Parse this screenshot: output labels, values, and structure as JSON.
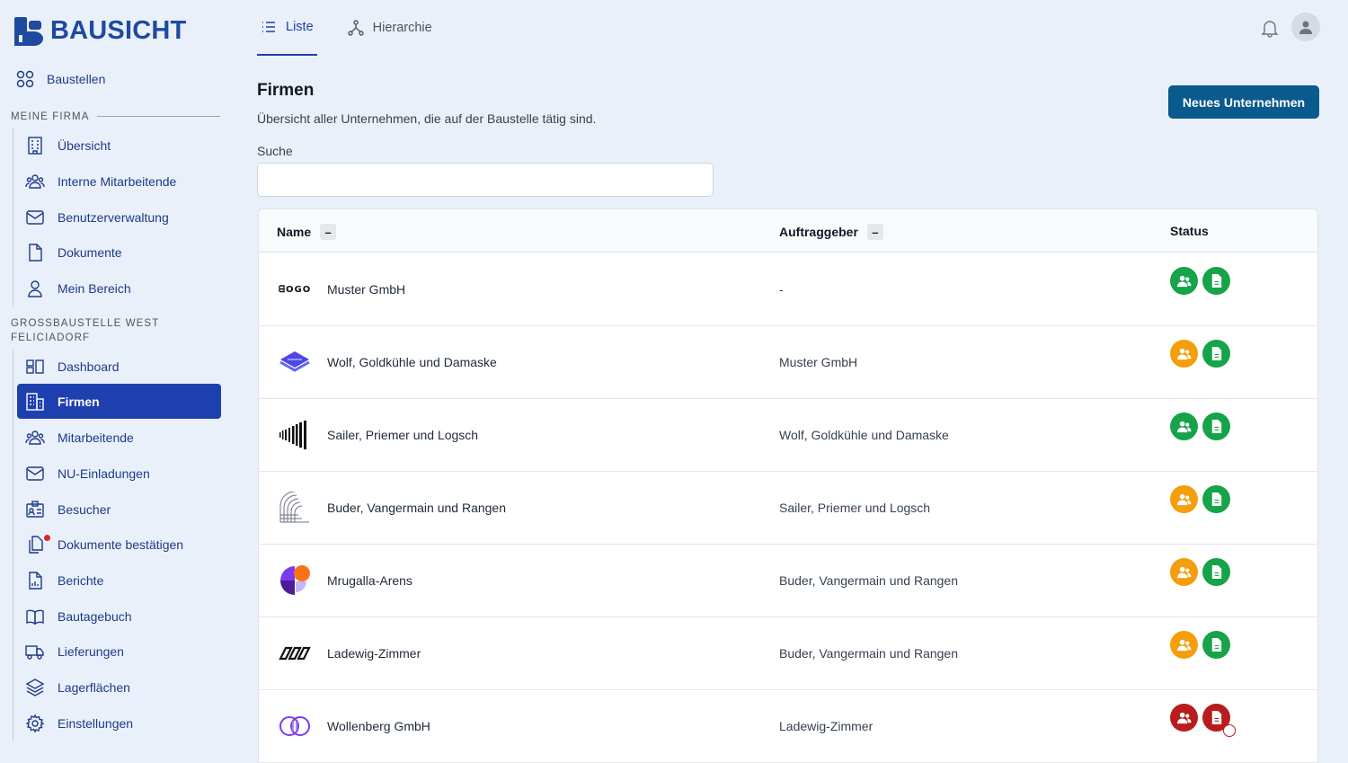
{
  "app": {
    "brand": "BAUSICHT"
  },
  "colors": {
    "brand": "#1e4aa0",
    "active_nav": "#1e40af",
    "primary_button": "#0b5a8e",
    "status_ok": "#16a34a",
    "status_warn": "#f59e0b",
    "status_error": "#b91c1c"
  },
  "sidebar": {
    "top_item": {
      "label": "Baustellen",
      "icon": "grid-icon"
    },
    "section1": "MEINE FIRMA",
    "group1": [
      {
        "label": "Übersicht",
        "icon": "building-icon"
      },
      {
        "label": "Interne Mitarbeitende",
        "icon": "users-icon"
      },
      {
        "label": "Benutzerverwaltung",
        "icon": "envelope-icon"
      },
      {
        "label": "Dokumente",
        "icon": "document-icon"
      },
      {
        "label": "Mein Bereich",
        "icon": "user-icon"
      }
    ],
    "section2_line1": "GROSSBAUSTELLE WEST",
    "section2_line2": "FELICIADORF",
    "group2": [
      {
        "label": "Dashboard",
        "icon": "dashboard-icon"
      },
      {
        "label": "Firmen",
        "icon": "building-icon",
        "active": true
      },
      {
        "label": "Mitarbeitende",
        "icon": "users-icon"
      },
      {
        "label": "NU-Einladungen",
        "icon": "envelope-icon"
      },
      {
        "label": "Besucher",
        "icon": "id-card-icon"
      },
      {
        "label": "Dokumente bestätigen",
        "icon": "documents-icon",
        "notification": true
      },
      {
        "label": "Berichte",
        "icon": "report-icon"
      },
      {
        "label": "Bautagebuch",
        "icon": "book-icon"
      },
      {
        "label": "Lieferungen",
        "icon": "truck-icon"
      },
      {
        "label": "Lagerflächen",
        "icon": "layers-icon"
      },
      {
        "label": "Einstellungen",
        "icon": "gear-icon"
      }
    ]
  },
  "header": {
    "tabs": [
      {
        "label": "Liste",
        "icon": "list-icon",
        "active": true
      },
      {
        "label": "Hierarchie",
        "icon": "hierarchy-icon"
      }
    ]
  },
  "main": {
    "title": "Firmen",
    "subtitle": "Übersicht aller Unternehmen, die auf der Baustelle tätig sind.",
    "new_button": "Neues Unternehmen",
    "search_label": "Suche",
    "search_value": "",
    "columns": {
      "name": "Name",
      "client": "Auftraggeber",
      "status": "Status",
      "collapse": "–"
    },
    "rows": [
      {
        "logo": "logo-text",
        "logo_text": "ᗺOGO",
        "name": "Muster GmbH",
        "client": "-",
        "staff_status": "green",
        "doc_status": "green"
      },
      {
        "logo": "layers-logo",
        "name": "Wolf, Goldkühle und Damaske",
        "client": "Muster GmbH",
        "staff_status": "orange",
        "doc_status": "green"
      },
      {
        "logo": "bars-logo",
        "name": "Sailer, Priemer und Logsch",
        "client": "Wolf, Goldkühle und Damaske",
        "staff_status": "green",
        "doc_status": "green"
      },
      {
        "logo": "stack-logo",
        "name": "Buder, Vangermain und Rangen",
        "client": "Sailer, Priemer und Logsch",
        "staff_status": "orange",
        "doc_status": "green"
      },
      {
        "logo": "pie-logo",
        "name": "Mrugalla-Arens",
        "client": "Buder, Vangermain und Rangen",
        "staff_status": "orange",
        "doc_status": "green"
      },
      {
        "logo": "chain-logo",
        "name": "Ladewig-Zimmer",
        "client": "Buder, Vangermain und Rangen",
        "staff_status": "orange",
        "doc_status": "green"
      },
      {
        "logo": "circles-logo",
        "name": "Wollenberg GmbH",
        "client": "Ladewig-Zimmer",
        "staff_status": "red",
        "doc_status": "red",
        "doc_pending": true
      }
    ]
  }
}
